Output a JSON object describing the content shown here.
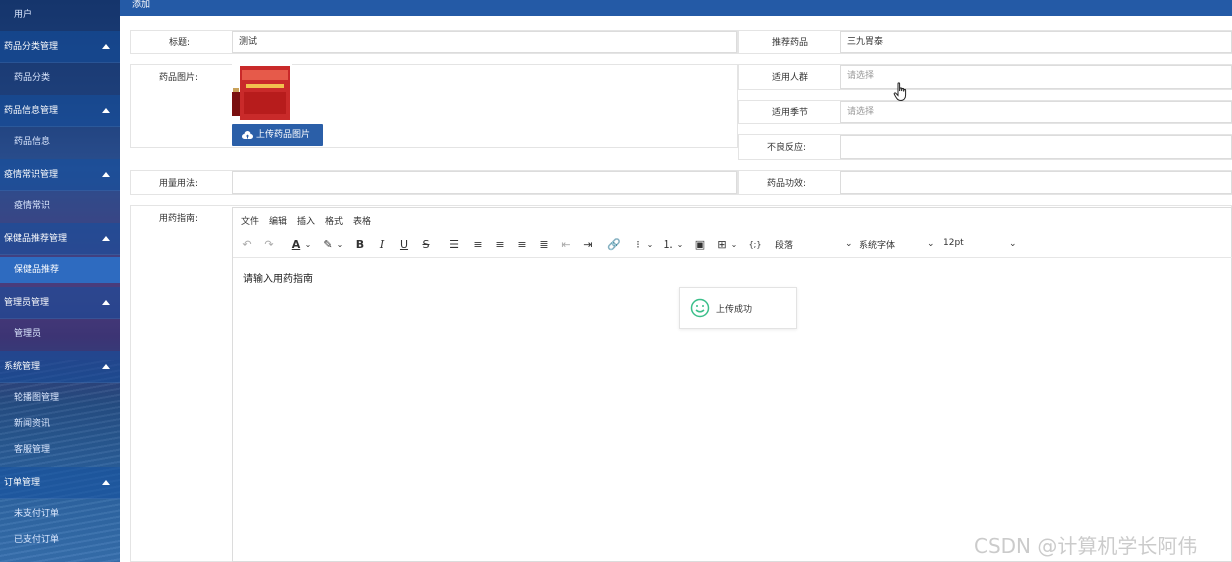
{
  "sidebar": {
    "items": [
      {
        "label": "用户",
        "type": "sub"
      },
      {
        "label": "药品分类管理",
        "type": "group"
      },
      {
        "label": "药品分类",
        "type": "sub"
      },
      {
        "label": "药品信息管理",
        "type": "group"
      },
      {
        "label": "药品信息",
        "type": "sub"
      },
      {
        "label": "疫情常识管理",
        "type": "group"
      },
      {
        "label": "疫情常识",
        "type": "sub"
      },
      {
        "label": "保健品推荐管理",
        "type": "group"
      },
      {
        "label": "保健品推荐",
        "type": "sub-active"
      },
      {
        "label": "管理员管理",
        "type": "group"
      },
      {
        "label": "管理员",
        "type": "sub"
      },
      {
        "label": "系统管理",
        "type": "group"
      },
      {
        "label": "轮播图管理",
        "type": "sub"
      },
      {
        "label": "新闻资讯",
        "type": "sub"
      },
      {
        "label": "客服管理",
        "type": "sub"
      },
      {
        "label": "订单管理",
        "type": "group"
      },
      {
        "label": "未支付订单",
        "type": "sub"
      },
      {
        "label": "已支付订单",
        "type": "sub"
      }
    ]
  },
  "topbar": {
    "title": "添加"
  },
  "form": {
    "title_label": "标题:",
    "title_value": "测试",
    "recommend_label": "推荐药品",
    "recommend_value": "三九胃泰",
    "image_label": "药品图片:",
    "upload_label": "上传药品图片",
    "crowd_label": "适用人群",
    "crowd_placeholder": "请选择",
    "season_label": "适用季节",
    "season_placeholder": "请选择",
    "adverse_label": "不良反应:",
    "usage_label": "用量用法:",
    "efficacy_label": "药品功效:",
    "guide_label": "用药指南:"
  },
  "editor": {
    "menus": [
      "文件",
      "编辑",
      "插入",
      "格式",
      "表格"
    ],
    "block_format": "段落",
    "font_family": "系统字体",
    "font_size": "12pt",
    "content": "请输入用药指南"
  },
  "toast": {
    "message": "上传成功"
  },
  "watermark": "CSDN @计算机学长阿伟",
  "colors": {
    "topbar": "#245aa6",
    "upload_button": "#2b5fa8",
    "toast_icon": "#3bbf8a"
  }
}
